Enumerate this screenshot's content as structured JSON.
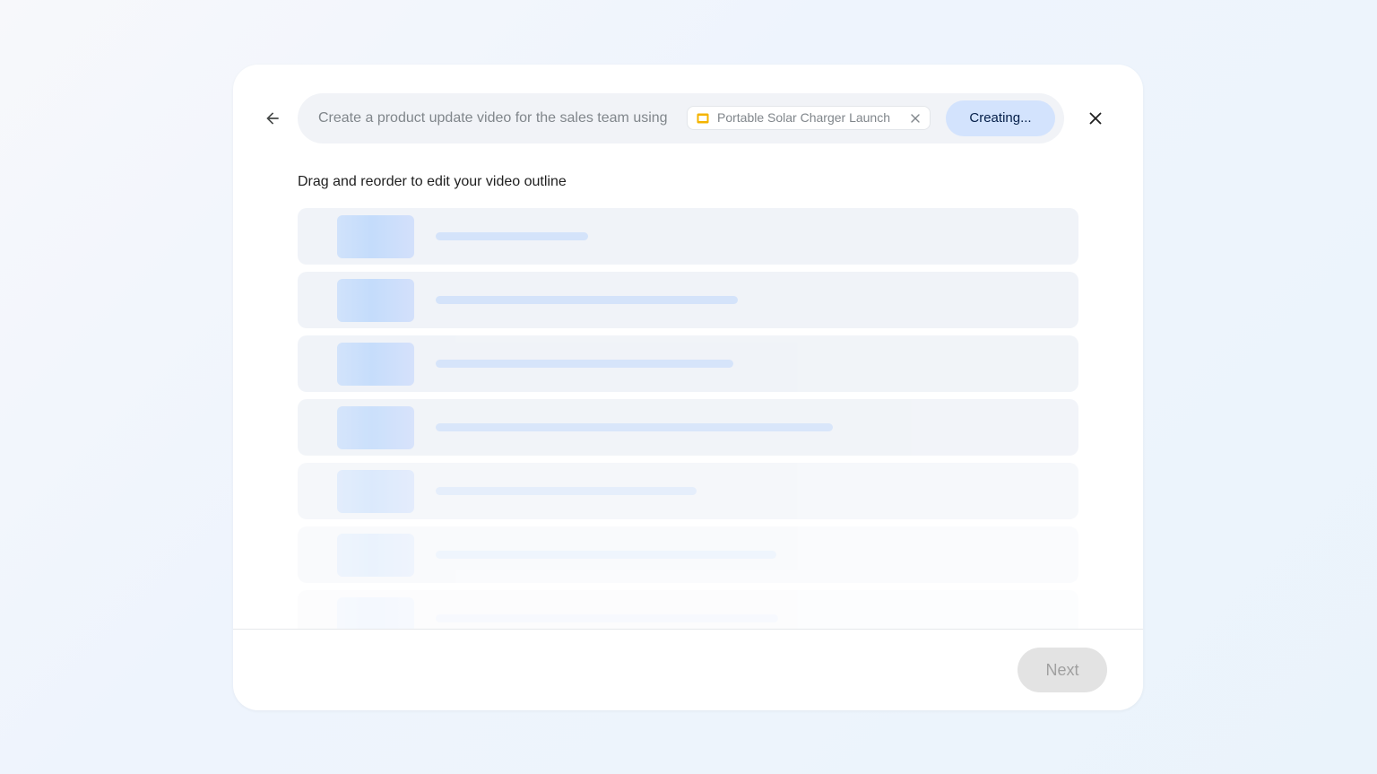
{
  "prompt": {
    "text": "Create a product update video for the sales team using",
    "chip_label": "Portable Solar Charger Launch",
    "chip_icon": "slides-icon",
    "chip_icon_color": "#f4b400",
    "status_label": "Creating..."
  },
  "outline": {
    "heading": "Drag and reorder to edit your video outline",
    "row_count": 7
  },
  "footer": {
    "next_label": "Next"
  },
  "colors": {
    "status_button_bg": "#d3e3fd",
    "row_bg": "#f0f3f8",
    "skeleton": "#d4e3fa",
    "next_disabled_bg": "#e3e3e3"
  }
}
